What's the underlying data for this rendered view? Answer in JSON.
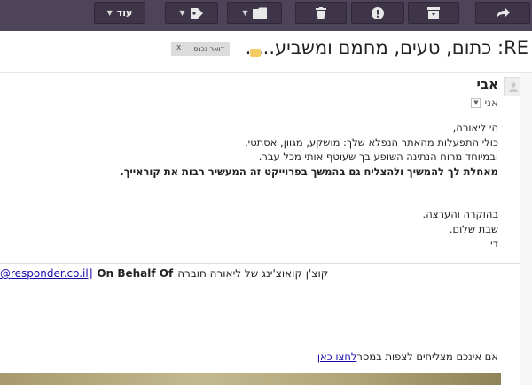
{
  "toolbar": {
    "more_label": "עוד",
    "buttons": [
      {
        "icon": "reply-icon"
      },
      {
        "icon": "archive-icon"
      },
      {
        "icon": "report-spam-icon"
      },
      {
        "icon": "delete-icon"
      },
      {
        "icon": "folder-move-icon"
      },
      {
        "icon": "label-tag-icon"
      },
      {
        "icon": "more-menu"
      }
    ]
  },
  "email": {
    "subject": "RE: כתום, טעים, מחמם ומשביע.....",
    "label_tag": "דואר נכנס",
    "label_remove": "x",
    "sender": "אבי",
    "recipient": "אני",
    "body": {
      "line1": "הי ליאורה,",
      "line2": "כולי התפעלות מהאתר הנפלא שלך: מושקע, מגוון, אסתטי,",
      "line3": "ובמיוחד מרוח הנתינה השופע בך שעוטף אותי מכל עבר.",
      "line4": "מאחלת לך להמשיך ולהצליח גם בהמשך בפרוייקט זה המעשיר רבות את קוראייך.",
      "closing1": "בהוקרה והערצה.",
      "closing2": "שבת שלום.",
      "closing3": "די"
    },
    "quoted_header": {
      "email": "@responder.co.il]",
      "on_behalf": "On Behalf Of",
      "sender_text": "קוצ'ן קואוצ'ינג של ליאורה חוברה"
    },
    "view_line": {
      "text": "אם אינכם מצליחים לצפות במסר",
      "link": "לחצו כאן"
    }
  },
  "colors": {
    "toolbar_bg": "#4e4459",
    "button_bg": "#3f3549",
    "link": "#1a0dab",
    "importance_marker": "#f3cc64"
  }
}
